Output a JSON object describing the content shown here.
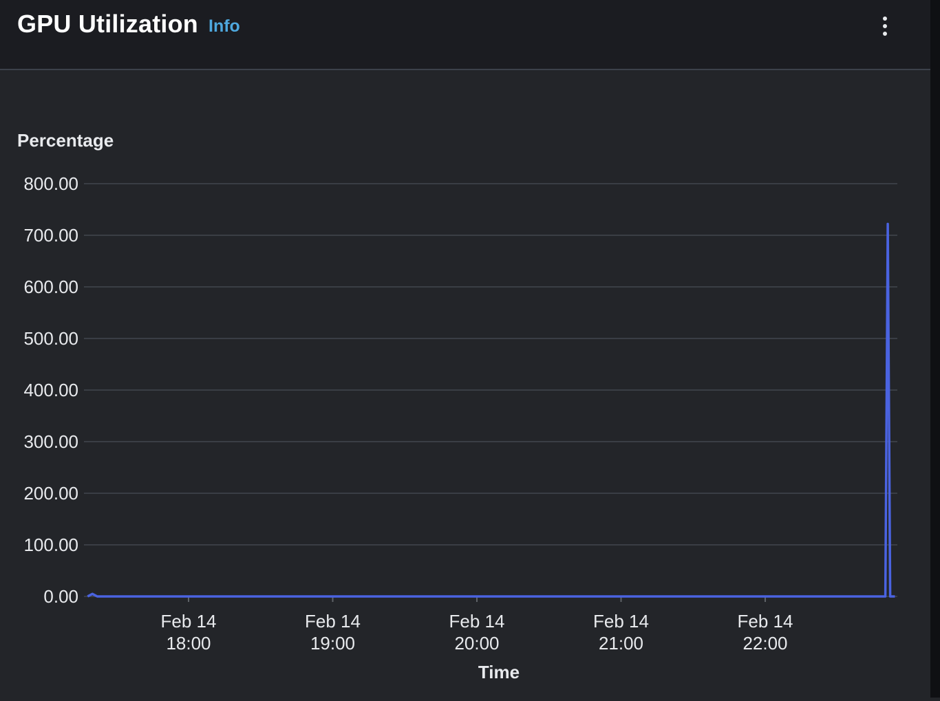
{
  "header": {
    "title": "GPU Utilization",
    "info_label": "Info",
    "menu_icon": "vertical-dots-icon"
  },
  "colors": {
    "background": "#232529",
    "header_background": "#1b1c21",
    "series_line": "#4a63e0",
    "info_link": "#4ea8de",
    "gridline": "#3a3e45"
  },
  "chart_data": {
    "type": "line",
    "ylabel": "Percentage",
    "xlabel": "Time",
    "ylim": [
      0,
      800
    ],
    "y_ticks": [
      "0.00",
      "100.00",
      "200.00",
      "300.00",
      "400.00",
      "500.00",
      "600.00",
      "700.00",
      "800.00"
    ],
    "x_ticks": [
      {
        "date": "Feb 14",
        "time": "18:00"
      },
      {
        "date": "Feb 14",
        "time": "19:00"
      },
      {
        "date": "Feb 14",
        "time": "20:00"
      },
      {
        "date": "Feb 14",
        "time": "21:00"
      },
      {
        "date": "Feb 14",
        "time": "22:00"
      }
    ],
    "x_range": [
      "Feb 14 17:18",
      "Feb 14 22:54"
    ],
    "grid": true,
    "legend": "none",
    "series": [
      {
        "points": [
          {
            "x": "Feb 14 17:18",
            "y": 0
          },
          {
            "x": "Feb 14 17:20",
            "y": 5
          },
          {
            "x": "Feb 14 17:22",
            "y": 0
          },
          {
            "x": "Feb 14 22:50",
            "y": 0
          },
          {
            "x": "Feb 14 22:51",
            "y": 722
          },
          {
            "x": "Feb 14 22:52",
            "y": 0
          },
          {
            "x": "Feb 14 22:54",
            "y": 0
          }
        ]
      }
    ]
  }
}
